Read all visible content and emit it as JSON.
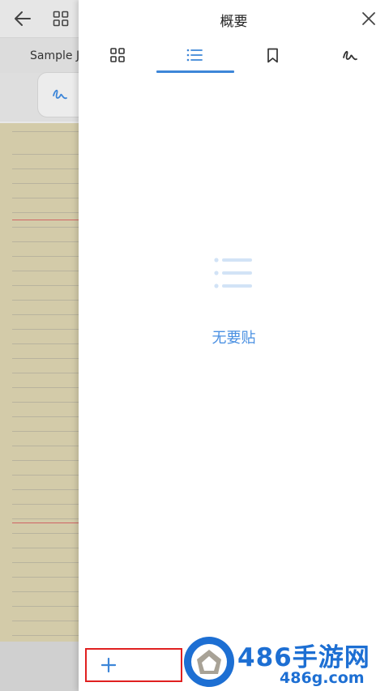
{
  "background_document": {
    "tab_label": "Sample J"
  },
  "panel": {
    "title": "概要",
    "tabs": [
      {
        "icon": "grid-icon",
        "active": false
      },
      {
        "icon": "list-icon",
        "active": true
      },
      {
        "icon": "bookmark-icon",
        "active": false
      },
      {
        "icon": "pen-icon",
        "active": false
      }
    ],
    "empty_message": "无要贴"
  },
  "watermark": {
    "title": "486手游网",
    "subtitle": "486g.com"
  },
  "colors": {
    "accent": "#3d86d8",
    "empty_text": "#4a90e2",
    "highlight_box": "#e02020",
    "watermark": "#1d6fd3"
  }
}
